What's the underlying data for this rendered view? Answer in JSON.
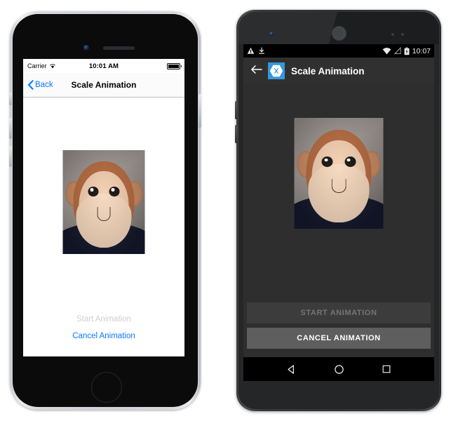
{
  "ios": {
    "status": {
      "carrier": "Carrier",
      "wifi_icon": "wifi-icon",
      "time": "10:01 AM",
      "battery_icon": "battery-full-icon"
    },
    "nav": {
      "back_label": "Back",
      "back_icon": "chevron-left-icon",
      "title": "Scale Animation"
    },
    "image": {
      "name": "monkey-photo",
      "alt": "Plush monkey toy"
    },
    "buttons": {
      "start_label": "Start Animation",
      "start_enabled": false,
      "cancel_label": "Cancel Animation",
      "cancel_enabled": true
    },
    "colors": {
      "accent": "#067aff",
      "disabled_text": "#cfcfd2",
      "background": "#ffffff"
    }
  },
  "android": {
    "status": {
      "warning_icon": "warning-triangle-icon",
      "download_icon": "download-icon",
      "wifi_icon": "wifi-icon",
      "signal_icon": "no-signal-icon",
      "battery_icon": "battery-charging-icon",
      "time": "10:07"
    },
    "appbar": {
      "back_icon": "arrow-left-icon",
      "logo_icon": "xamarin-logo-icon",
      "title": "Scale Animation"
    },
    "image": {
      "name": "monkey-photo",
      "alt": "Plush monkey toy"
    },
    "buttons": {
      "start_label": "START ANIMATION",
      "start_enabled": false,
      "cancel_label": "CANCEL ANIMATION",
      "cancel_enabled": true
    },
    "navbar": {
      "back_icon": "nav-back-triangle-icon",
      "home_icon": "nav-home-circle-icon",
      "recents_icon": "nav-recents-square-icon"
    },
    "colors": {
      "accent": "#3498db",
      "appbar": "#303030",
      "background": "#2e2e2e",
      "button_enabled": "#5e5e5e",
      "button_disabled": "#3c3c3c",
      "disabled_text": "#757575"
    }
  }
}
